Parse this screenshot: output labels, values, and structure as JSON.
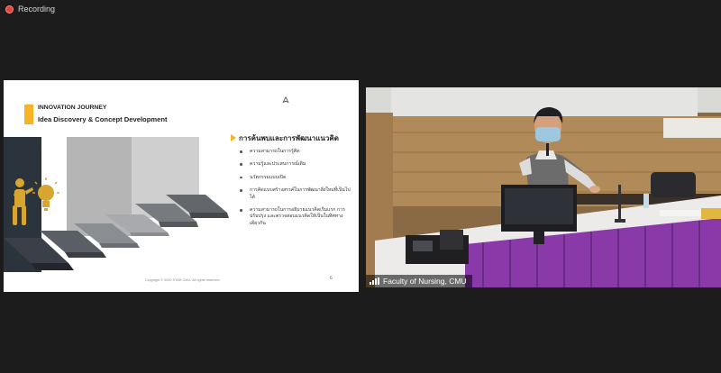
{
  "recording": {
    "label": "Recording",
    "dot_color": "#e0473c"
  },
  "slide": {
    "kicker": "INNOVATION JOURNEY",
    "title": "Idea Discovery & Concept Development",
    "section_heading": "การค้นพบและการพัฒนาแนวคิด",
    "bullets": [
      "ความสามารถในการรู้คิด",
      "ความรู้และประสบการณ์เดิม",
      "นวัตกรรมแบบเปิด",
      "การคิดแบบสร้างสรรค์ในการพัฒนาสิ่งใหม่ที่เป็นไปได้",
      "ความสามารถในการอธิบายแนวคิดเริ่มแรก การปรับปรุง และตรวจสอบแนวคิดให้เป็นในทิศทางเดียวกัน"
    ],
    "copyright": "Copyright © 2020 STAR CMU. All rights reserved.",
    "page_number": "6",
    "accent_color": "#f5b325"
  },
  "video": {
    "participant_name": "Faculty of Nursing, CMU"
  }
}
